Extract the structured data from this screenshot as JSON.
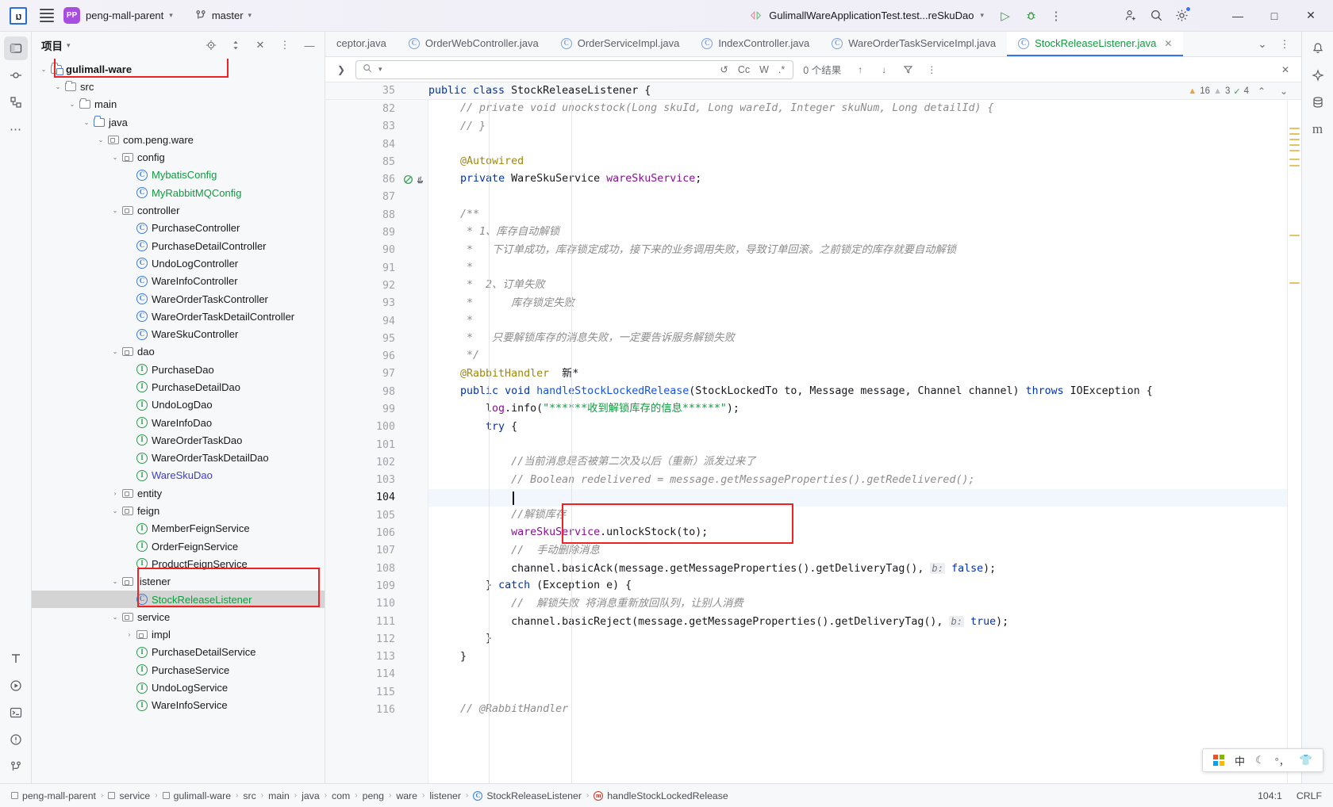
{
  "titlebar": {
    "logo": "IJ",
    "menu_icon": "hamburger-icon",
    "project_badge": "PP",
    "project_name": "peng-mall-parent",
    "branch_icon": "branch-icon",
    "branch_name": "master",
    "run_config": "GulimallWareApplicationTest.test...reSkuDao",
    "run_icon": "run-icon",
    "debug_icon": "debug-icon",
    "more_icon": "more-vertical-icon",
    "account_icon": "account-add-icon",
    "search_icon": "search-icon",
    "settings_icon": "gear-icon",
    "minimize": "—",
    "maximize": "☐",
    "close": "✕"
  },
  "left_rail": {
    "items": [
      {
        "name": "project-tool-icon",
        "glyph": "▭"
      },
      {
        "name": "commit-tool-icon",
        "glyph": "⎇"
      },
      {
        "name": "structure-tool-icon",
        "glyph": "⊞"
      },
      {
        "name": "more-tools-icon",
        "glyph": "⋯"
      }
    ],
    "bottom_items": [
      {
        "name": "terminal-ai-icon",
        "glyph": "T"
      },
      {
        "name": "run-tool-icon",
        "glyph": "▷"
      },
      {
        "name": "terminal-tool-icon",
        "glyph": "⌨"
      },
      {
        "name": "problems-tool-icon",
        "glyph": "ⓘ"
      },
      {
        "name": "git-tool-icon",
        "glyph": "⎇"
      }
    ]
  },
  "project_panel": {
    "title": "项目",
    "header_icons": [
      {
        "name": "locate-file-icon",
        "glyph": "⌖"
      },
      {
        "name": "expand-collapse-icon",
        "glyph": "↕"
      },
      {
        "name": "collapse-all-icon",
        "glyph": "✕"
      },
      {
        "name": "panel-options-icon",
        "glyph": "⋮"
      },
      {
        "name": "hide-panel-icon",
        "glyph": "—"
      }
    ],
    "tree": [
      {
        "label": "gulimall-ware",
        "depth": 2,
        "icon": "module-folder-icon",
        "arrow": "down",
        "style": "bold",
        "highlighted": true
      },
      {
        "label": "src",
        "depth": 3,
        "icon": "folder-icon",
        "arrow": "down",
        "style": "normal"
      },
      {
        "label": "main",
        "depth": 4,
        "icon": "folder-icon",
        "arrow": "down",
        "style": "normal"
      },
      {
        "label": "java",
        "depth": 5,
        "icon": "source-folder-icon",
        "arrow": "down",
        "style": "normal"
      },
      {
        "label": "com.peng.ware",
        "depth": 6,
        "icon": "package-icon",
        "arrow": "down",
        "style": "normal"
      },
      {
        "label": "config",
        "depth": 7,
        "icon": "package-icon",
        "arrow": "down",
        "style": "normal"
      },
      {
        "label": "MybatisConfig",
        "depth": 8,
        "icon": "class-icon",
        "arrow": "none",
        "style": "green"
      },
      {
        "label": "MyRabbitMQConfig",
        "depth": 8,
        "icon": "class-icon",
        "arrow": "none",
        "style": "green"
      },
      {
        "label": "controller",
        "depth": 7,
        "icon": "package-icon",
        "arrow": "down",
        "style": "normal"
      },
      {
        "label": "PurchaseController",
        "depth": 8,
        "icon": "class-icon",
        "arrow": "none",
        "style": "normal"
      },
      {
        "label": "PurchaseDetailController",
        "depth": 8,
        "icon": "class-icon",
        "arrow": "none",
        "style": "normal"
      },
      {
        "label": "UndoLogController",
        "depth": 8,
        "icon": "class-icon",
        "arrow": "none",
        "style": "normal"
      },
      {
        "label": "WareInfoController",
        "depth": 8,
        "icon": "class-icon",
        "arrow": "none",
        "style": "normal"
      },
      {
        "label": "WareOrderTaskController",
        "depth": 8,
        "icon": "class-icon",
        "arrow": "none",
        "style": "normal"
      },
      {
        "label": "WareOrderTaskDetailController",
        "depth": 8,
        "icon": "class-icon",
        "arrow": "none",
        "style": "normal"
      },
      {
        "label": "WareSkuController",
        "depth": 8,
        "icon": "class-icon",
        "arrow": "none",
        "style": "normal"
      },
      {
        "label": "dao",
        "depth": 7,
        "icon": "package-icon",
        "arrow": "down",
        "style": "normal"
      },
      {
        "label": "PurchaseDao",
        "depth": 8,
        "icon": "interface-icon",
        "arrow": "none",
        "style": "normal"
      },
      {
        "label": "PurchaseDetailDao",
        "depth": 8,
        "icon": "interface-icon",
        "arrow": "none",
        "style": "normal"
      },
      {
        "label": "UndoLogDao",
        "depth": 8,
        "icon": "interface-icon",
        "arrow": "none",
        "style": "normal"
      },
      {
        "label": "WareInfoDao",
        "depth": 8,
        "icon": "interface-icon",
        "arrow": "none",
        "style": "normal"
      },
      {
        "label": "WareOrderTaskDao",
        "depth": 8,
        "icon": "interface-icon",
        "arrow": "none",
        "style": "normal"
      },
      {
        "label": "WareOrderTaskDetailDao",
        "depth": 8,
        "icon": "interface-icon",
        "arrow": "none",
        "style": "normal"
      },
      {
        "label": "WareSkuDao",
        "depth": 8,
        "icon": "interface-icon",
        "arrow": "none",
        "style": "blue"
      },
      {
        "label": "entity",
        "depth": 7,
        "icon": "package-icon",
        "arrow": "right",
        "style": "normal"
      },
      {
        "label": "feign",
        "depth": 7,
        "icon": "package-icon",
        "arrow": "down",
        "style": "normal"
      },
      {
        "label": "MemberFeignService",
        "depth": 8,
        "icon": "interface-icon",
        "arrow": "none",
        "style": "normal"
      },
      {
        "label": "OrderFeignService",
        "depth": 8,
        "icon": "interface-icon",
        "arrow": "none",
        "style": "normal"
      },
      {
        "label": "ProductFeignService",
        "depth": 8,
        "icon": "interface-icon",
        "arrow": "none",
        "style": "normal"
      },
      {
        "label": "listener",
        "depth": 7,
        "icon": "package-icon",
        "arrow": "down",
        "style": "normal",
        "highlighted": true
      },
      {
        "label": "StockReleaseListener",
        "depth": 8,
        "icon": "class-icon",
        "arrow": "none",
        "style": "green",
        "selected": true,
        "highlighted": true
      },
      {
        "label": "service",
        "depth": 7,
        "icon": "package-icon",
        "arrow": "down",
        "style": "normal"
      },
      {
        "label": "impl",
        "depth": 8,
        "icon": "package-icon",
        "arrow": "right",
        "style": "normal"
      },
      {
        "label": "PurchaseDetailService",
        "depth": 8,
        "icon": "interface-icon",
        "arrow": "none",
        "style": "normal"
      },
      {
        "label": "PurchaseService",
        "depth": 8,
        "icon": "interface-icon",
        "arrow": "none",
        "style": "normal"
      },
      {
        "label": "UndoLogService",
        "depth": 8,
        "icon": "interface-icon",
        "arrow": "none",
        "style": "normal"
      },
      {
        "label": "WareInfoService",
        "depth": 8,
        "icon": "interface-icon",
        "arrow": "none",
        "style": "normal"
      }
    ]
  },
  "editor": {
    "tabs": [
      {
        "label": "ceptor.java",
        "icon": "none",
        "active": false
      },
      {
        "label": "OrderWebController.java",
        "icon": "class-icon",
        "active": false
      },
      {
        "label": "OrderServiceImpl.java",
        "icon": "class-icon",
        "active": false
      },
      {
        "label": "IndexController.java",
        "icon": "class-icon",
        "active": false
      },
      {
        "label": "WareOrderTaskServiceImpl.java",
        "icon": "class-icon",
        "active": false
      },
      {
        "label": "StockReleaseListener.java",
        "icon": "class-icon",
        "active": true
      }
    ],
    "tab_controls": [
      {
        "name": "tab-close-icon",
        "glyph": "✕"
      },
      {
        "name": "tab-list-icon",
        "glyph": "⌄"
      },
      {
        "name": "tab-options-icon",
        "glyph": "⋮"
      }
    ],
    "findbar": {
      "expand_icon": "chevron-right-icon",
      "search_icon": "search-icon",
      "value": "",
      "placeholder": "",
      "opt_regex_history": "↺",
      "opt_case": "Cc",
      "opt_words": "W",
      "opt_regex": ".*",
      "result_count": "0 个结果",
      "prev_icon": "↑",
      "next_icon": "↓",
      "filter_icon": "∇",
      "more_icon": "⋮",
      "close_icon": "✕"
    },
    "sticky_line": {
      "num": "35",
      "text": "public class StockReleaseListener {"
    },
    "inspections": {
      "warnings": "16",
      "weak_warnings": "3",
      "typos": "4",
      "up_icon": "⌃",
      "down_icon": "⌄"
    },
    "lines": [
      {
        "num": "82",
        "segments": [
          {
            "t": "    // private void unockstock(Long skuId, Long wareId, Integer skuNum, Long detailId) {",
            "c": "cmt"
          }
        ]
      },
      {
        "num": "83",
        "segments": [
          {
            "t": "    // }",
            "c": "cmt"
          }
        ]
      },
      {
        "num": "84",
        "segments": [
          {
            "t": "",
            "c": "typ"
          }
        ]
      },
      {
        "num": "85",
        "segments": [
          {
            "t": "    @Autowired",
            "c": "ann"
          }
        ]
      },
      {
        "num": "86",
        "segments": [
          {
            "t": "    ",
            "c": "typ"
          },
          {
            "t": "private",
            "c": "kw"
          },
          {
            "t": " WareSkuService ",
            "c": "typ"
          },
          {
            "t": "wareSkuService",
            "c": "fld-name"
          },
          {
            "t": ";",
            "c": "typ"
          }
        ],
        "gutter_icons": [
          "override-icon",
          "bean-icon"
        ]
      },
      {
        "num": "87",
        "segments": [
          {
            "t": "",
            "c": "typ"
          }
        ]
      },
      {
        "num": "88",
        "segments": [
          {
            "t": "    /**",
            "c": "cmt"
          }
        ]
      },
      {
        "num": "89",
        "segments": [
          {
            "t": "     * 1、库存自动解锁",
            "c": "cmt"
          }
        ]
      },
      {
        "num": "90",
        "segments": [
          {
            "t": "     *   下订单成功，库存锁定成功，接下来的业务调用失败，导致订单回滚。之前锁定的库存就要自动解锁",
            "c": "cmt"
          }
        ]
      },
      {
        "num": "91",
        "segments": [
          {
            "t": "     *",
            "c": "cmt"
          }
        ]
      },
      {
        "num": "92",
        "segments": [
          {
            "t": "     *  2、订单失败",
            "c": "cmt"
          }
        ]
      },
      {
        "num": "93",
        "segments": [
          {
            "t": "     *      库存锁定失败",
            "c": "cmt"
          }
        ]
      },
      {
        "num": "94",
        "segments": [
          {
            "t": "     *",
            "c": "cmt"
          }
        ]
      },
      {
        "num": "95",
        "segments": [
          {
            "t": "     *   只要解锁库存的消息失败，一定要告诉服务解锁失败",
            "c": "cmt"
          }
        ]
      },
      {
        "num": "96",
        "segments": [
          {
            "t": "     */",
            "c": "cmt"
          }
        ]
      },
      {
        "num": "97",
        "segments": [
          {
            "t": "    @RabbitHandler",
            "c": "ann"
          },
          {
            "t": "  新*",
            "c": "typ"
          }
        ]
      },
      {
        "num": "98",
        "segments": [
          {
            "t": "    ",
            "c": "typ"
          },
          {
            "t": "public",
            "c": "kw"
          },
          {
            "t": " ",
            "c": "typ"
          },
          {
            "t": "void",
            "c": "kw"
          },
          {
            "t": " ",
            "c": "typ"
          },
          {
            "t": "handleStockLockedRelease",
            "c": "mth"
          },
          {
            "t": "(StockLockedTo to, Message message, Channel channel) ",
            "c": "typ"
          },
          {
            "t": "throws",
            "c": "kw"
          },
          {
            "t": " IOException {",
            "c": "typ"
          }
        ]
      },
      {
        "num": "99",
        "segments": [
          {
            "t": "        ",
            "c": "typ"
          },
          {
            "t": "log",
            "c": "fld-name"
          },
          {
            "t": ".info(",
            "c": "typ"
          },
          {
            "t": "\"******收到解锁库存的信息******\"",
            "c": "str"
          },
          {
            "t": ");",
            "c": "typ"
          }
        ]
      },
      {
        "num": "100",
        "segments": [
          {
            "t": "        ",
            "c": "typ"
          },
          {
            "t": "try",
            "c": "kw"
          },
          {
            "t": " {",
            "c": "typ"
          }
        ]
      },
      {
        "num": "101",
        "segments": [
          {
            "t": "",
            "c": "typ"
          }
        ]
      },
      {
        "num": "102",
        "segments": [
          {
            "t": "            //当前消息是否被第二次及以后（重新）派发过来了",
            "c": "cmt"
          }
        ]
      },
      {
        "num": "103",
        "segments": [
          {
            "t": "            // Boolean redelivered = message.getMessageProperties().getRedelivered();",
            "c": "cmt"
          }
        ]
      },
      {
        "num": "104",
        "segments": [
          {
            "t": "",
            "c": "typ"
          }
        ],
        "current": true
      },
      {
        "num": "105",
        "segments": [
          {
            "t": "            //解锁库存",
            "c": "cmt"
          }
        ]
      },
      {
        "num": "106",
        "segments": [
          {
            "t": "            ",
            "c": "typ"
          },
          {
            "t": "wareSkuService",
            "c": "fld-name"
          },
          {
            "t": ".unlockStock(to);",
            "c": "typ"
          }
        ]
      },
      {
        "num": "107",
        "segments": [
          {
            "t": "            //  手动删除消息",
            "c": "cmt"
          }
        ]
      },
      {
        "num": "108",
        "segments": [
          {
            "t": "            channel.basicAck(message.getMessageProperties().getDeliveryTag(), ",
            "c": "typ"
          },
          {
            "t": "b:",
            "c": "hint"
          },
          {
            "t": " ",
            "c": "typ"
          },
          {
            "t": "false",
            "c": "kw"
          },
          {
            "t": ");",
            "c": "typ"
          }
        ]
      },
      {
        "num": "109",
        "segments": [
          {
            "t": "        } ",
            "c": "typ"
          },
          {
            "t": "catch",
            "c": "kw"
          },
          {
            "t": " (Exception e) {",
            "c": "typ"
          }
        ]
      },
      {
        "num": "110",
        "segments": [
          {
            "t": "            //  解锁失败 将消息重新放回队列，让别人消费",
            "c": "cmt"
          }
        ]
      },
      {
        "num": "111",
        "segments": [
          {
            "t": "            channel.basicReject(message.getMessageProperties().getDeliveryTag(), ",
            "c": "typ"
          },
          {
            "t": "b:",
            "c": "hint"
          },
          {
            "t": " ",
            "c": "typ"
          },
          {
            "t": "true",
            "c": "kw"
          },
          {
            "t": ");",
            "c": "typ"
          }
        ]
      },
      {
        "num": "112",
        "segments": [
          {
            "t": "        }",
            "c": "typ"
          }
        ]
      },
      {
        "num": "113",
        "segments": [
          {
            "t": "    }",
            "c": "typ"
          }
        ]
      },
      {
        "num": "114",
        "segments": [
          {
            "t": "",
            "c": "typ"
          }
        ]
      },
      {
        "num": "115",
        "segments": [
          {
            "t": "",
            "c": "typ"
          }
        ]
      },
      {
        "num": "116",
        "segments": [
          {
            "t": "    // @RabbitHandler",
            "c": "cmt"
          }
        ]
      }
    ]
  },
  "right_rail": {
    "items": [
      {
        "name": "notifications-icon",
        "glyph": "⚑"
      },
      {
        "name": "ai-assistant-icon",
        "glyph": "◈"
      },
      {
        "name": "database-icon",
        "glyph": "⌸"
      },
      {
        "name": "maven-icon",
        "glyph": "m"
      }
    ]
  },
  "status_bar": {
    "breadcrumbs": [
      {
        "label": "peng-mall-parent",
        "icon": "folder-icon"
      },
      {
        "label": "service",
        "icon": "folder-icon"
      },
      {
        "label": "gulimall-ware",
        "icon": "folder-icon"
      },
      {
        "label": "src",
        "icon": "none"
      },
      {
        "label": "main",
        "icon": "none"
      },
      {
        "label": "java",
        "icon": "none"
      },
      {
        "label": "com",
        "icon": "none"
      },
      {
        "label": "peng",
        "icon": "none"
      },
      {
        "label": "ware",
        "icon": "none"
      },
      {
        "label": "listener",
        "icon": "none"
      },
      {
        "label": "StockReleaseListener",
        "icon": "class-icon"
      },
      {
        "label": "handleStockLockedRelease",
        "icon": "method-icon"
      }
    ],
    "caret": "104:1",
    "line_separator": "CRLF"
  },
  "ime_popup": {
    "windows_icon": "windows-logo-icon",
    "mode": "中",
    "moon_icon": "☾",
    "punct_icon": "°，",
    "skin_icon": "👕"
  },
  "colors": {
    "accent": "#3574f0",
    "green": "#0f9b3e",
    "annotation": "#9e880d",
    "keyword": "#0033b3",
    "comment": "#8c8c8c",
    "field": "#871094",
    "highlight_box": "#ee2222",
    "branch_badge": "#a74ee0"
  }
}
